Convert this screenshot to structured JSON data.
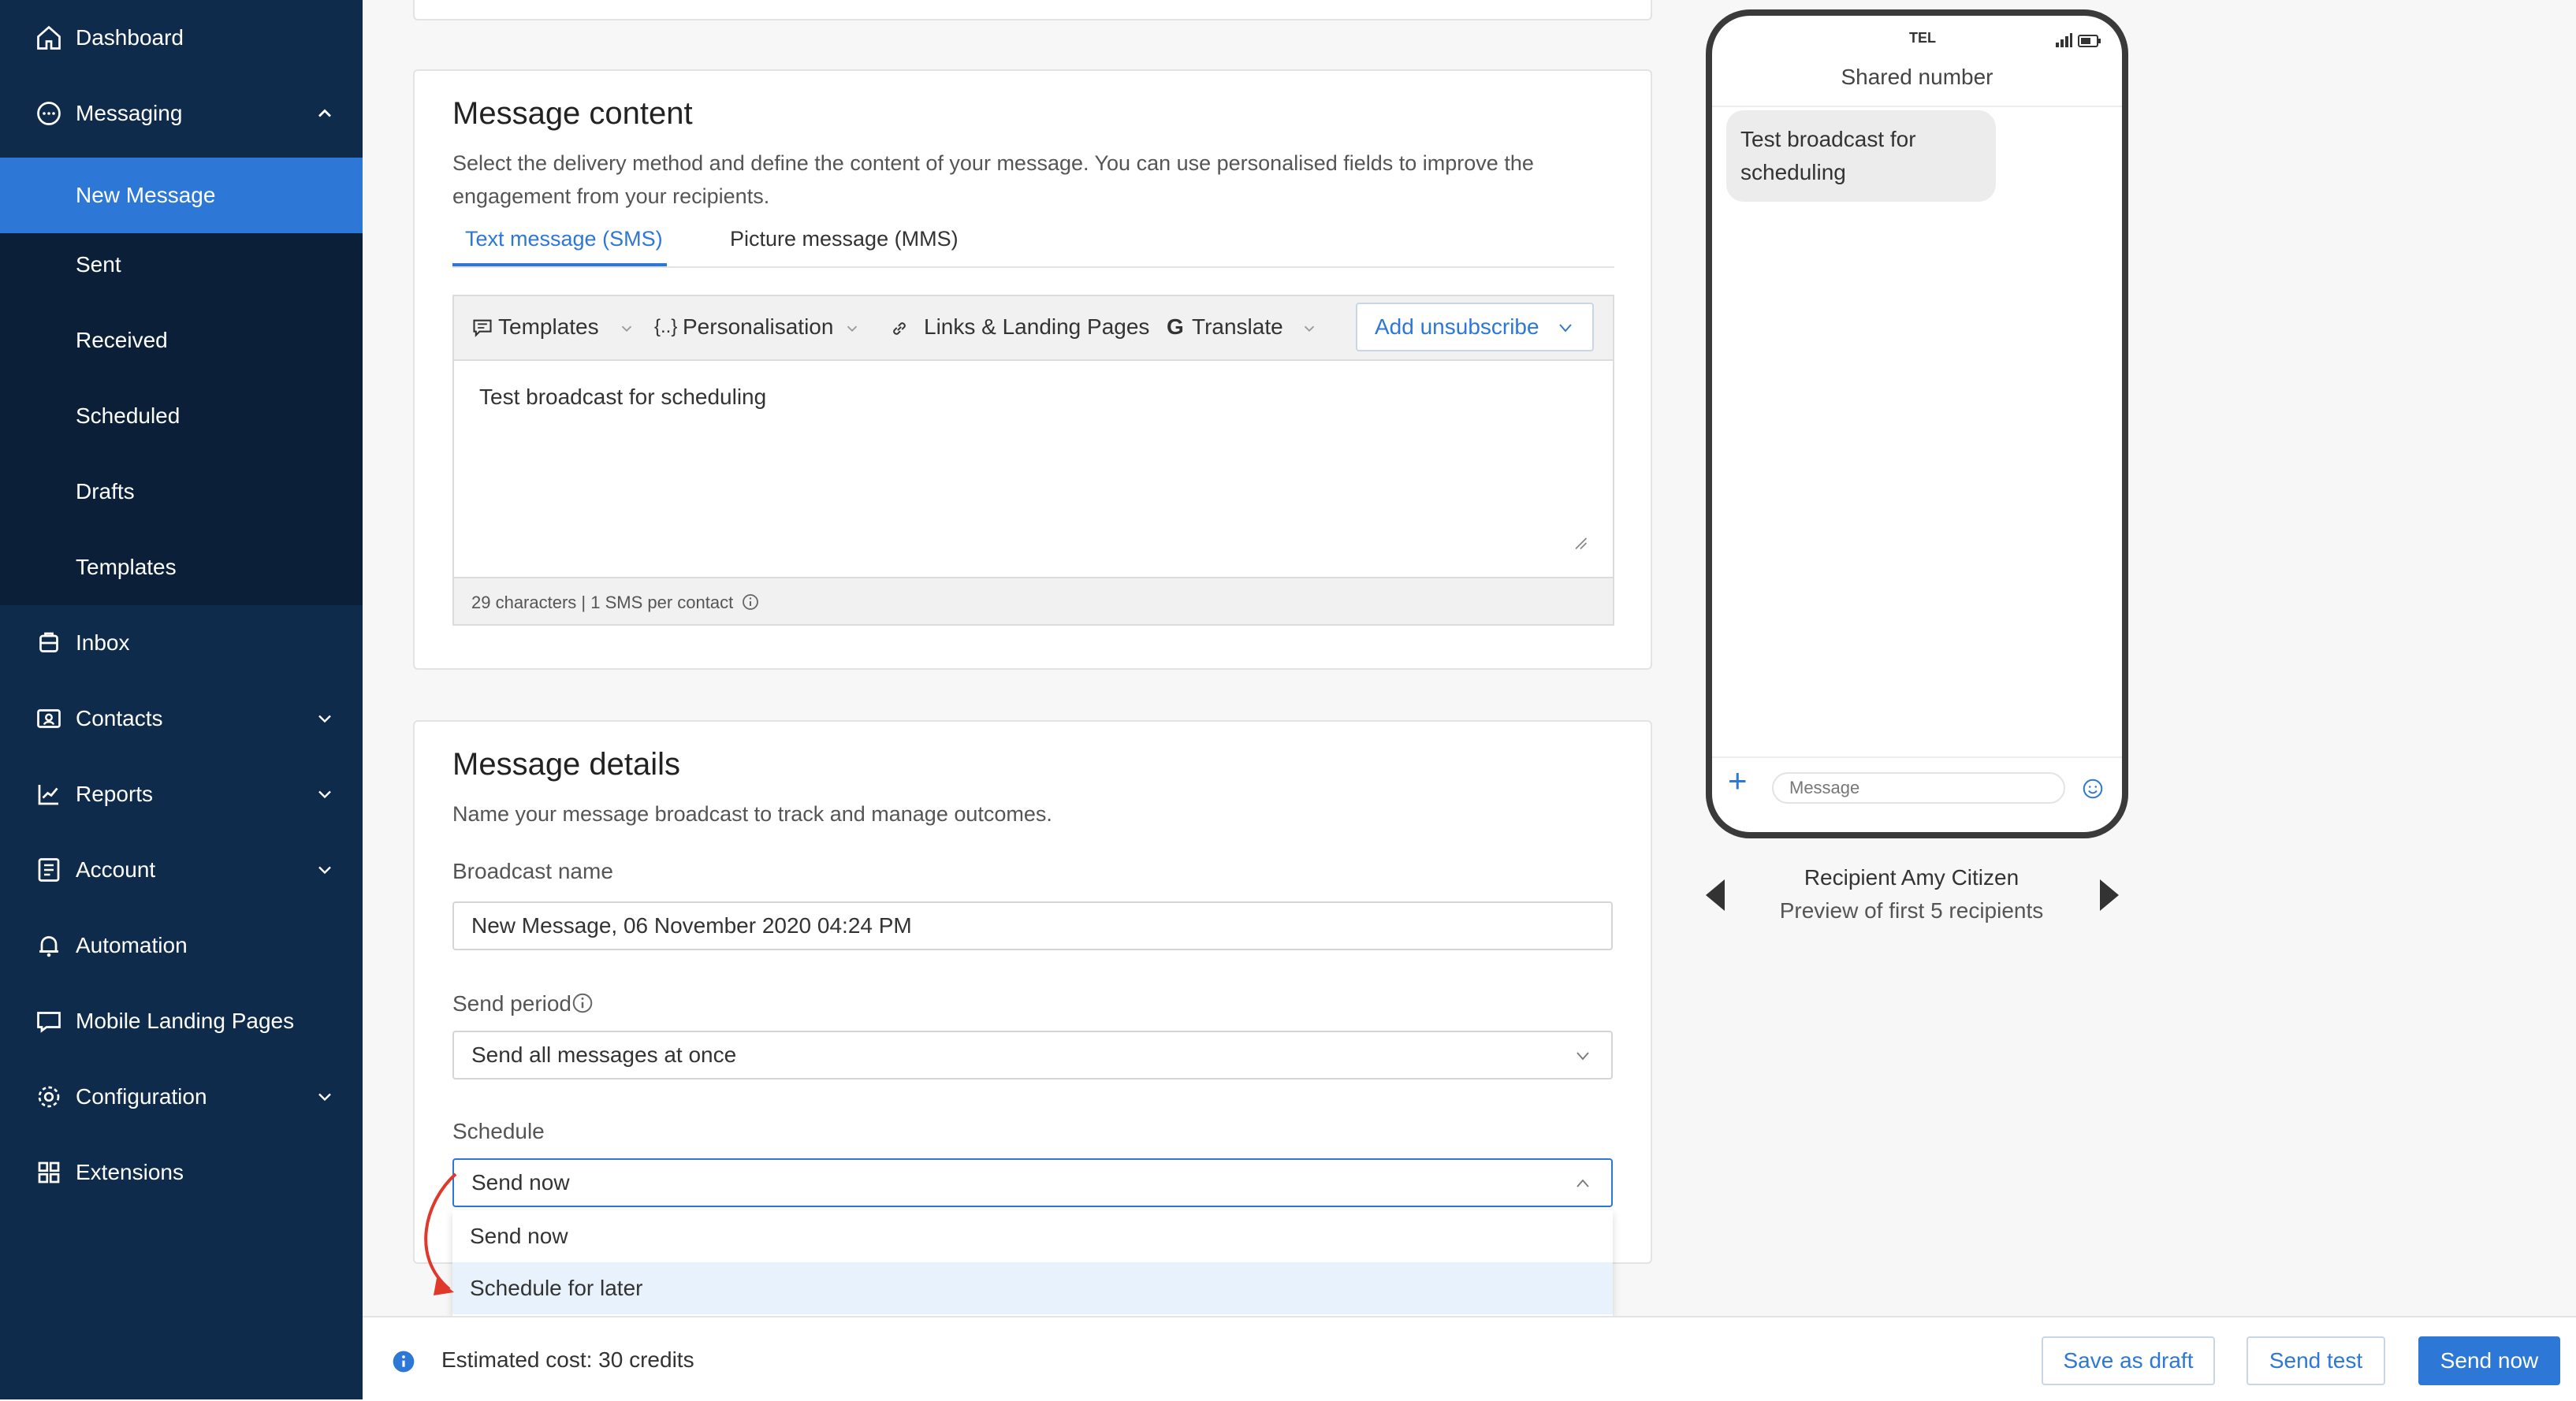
{
  "sidebar": {
    "items": [
      {
        "label": "Dashboard",
        "icon": "home-icon"
      },
      {
        "label": "Messaging",
        "icon": "chat-icon"
      },
      {
        "label": "New Message"
      },
      {
        "label": "Sent"
      },
      {
        "label": "Received"
      },
      {
        "label": "Scheduled"
      },
      {
        "label": "Drafts"
      },
      {
        "label": "Templates"
      },
      {
        "label": "Inbox",
        "icon": "inbox-icon"
      },
      {
        "label": "Contacts",
        "icon": "contacts-icon"
      },
      {
        "label": "Reports",
        "icon": "chart-icon"
      },
      {
        "label": "Account",
        "icon": "account-icon"
      },
      {
        "label": "Automation",
        "icon": "bell-icon"
      },
      {
        "label": "Mobile Landing Pages",
        "icon": "mobile-page-icon"
      },
      {
        "label": "Configuration",
        "icon": "gear-icon"
      },
      {
        "label": "Extensions",
        "icon": "grid-icon"
      }
    ],
    "active": "New Message"
  },
  "content": {
    "title": "Message content",
    "description": "Select the delivery method and define the content of your message. You can use personalised fields to improve the engagement from your recipients.",
    "tabs": [
      "Text message (SMS)",
      "Picture message (MMS)"
    ],
    "toolbar": {
      "templates": "Templates",
      "personalisation": "Personalisation",
      "links": "Links & Landing Pages",
      "translate": "Translate",
      "unsubscribe": "Add unsubscribe"
    },
    "message_text": "Test broadcast for scheduling",
    "counter": "29 characters | 1 SMS per contact"
  },
  "details": {
    "title": "Message details",
    "description": "Name your message broadcast to track and manage outcomes.",
    "broadcast_label": "Broadcast name",
    "broadcast_value": "New Message, 06 November 2020 04:24 PM",
    "period_label": "Send period",
    "period_value": "Send all messages at once",
    "schedule_label": "Schedule",
    "schedule_value": "Send now",
    "schedule_options": [
      "Send now",
      "Schedule for later"
    ]
  },
  "footer": {
    "cost": "Estimated cost: 30 credits",
    "save_draft": "Save as draft",
    "send_test": "Send test",
    "send_now": "Send now"
  },
  "preview": {
    "carrier": "TEL",
    "header": "Shared number",
    "bubble": "Test broadcast for scheduling",
    "input_placeholder": "Message",
    "recipient": "Recipient Amy Citizen",
    "preview_note": "Preview of first 5 recipients"
  },
  "colors": {
    "sidebar": "#0f2b4c",
    "accent": "#2d77d6",
    "annotation_arrow": "#e0382b"
  }
}
